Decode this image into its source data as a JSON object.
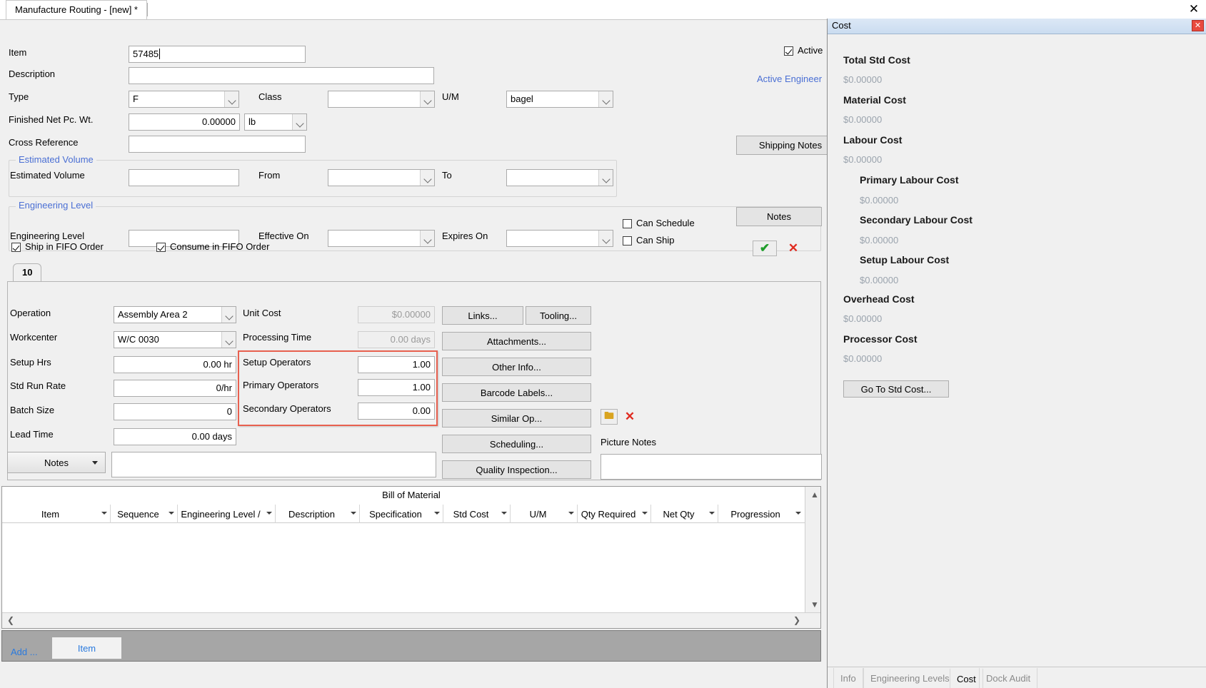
{
  "window": {
    "tab_title": "Manufacture Routing - [new] *",
    "close_icon": "close-icon"
  },
  "header_fields": {
    "item_label": "Item",
    "item_value": "57485",
    "description_label": "Description",
    "description_value": "",
    "type_label": "Type",
    "type_value": "F",
    "class_label": "Class",
    "class_value": "",
    "um_label": "U/M",
    "um_value": "bagel",
    "finished_net_label": "Finished Net Pc. Wt.",
    "finished_net_value": "0.00000",
    "finished_net_unit": "lb",
    "cross_ref_label": "Cross Reference",
    "cross_ref_value": "",
    "active_label": "Active",
    "active_checked": true,
    "active_engineer_link": "Active Engineer",
    "shipping_notes_button": "Shipping Notes"
  },
  "estimated_volume": {
    "group_title": "Estimated Volume",
    "field_label": "Estimated Volume",
    "field_value": "",
    "from_label": "From",
    "from_value": "",
    "to_label": "To",
    "to_value": ""
  },
  "engineering_level": {
    "group_title": "Engineering Level",
    "field_label": "Engineering Level",
    "field_value": "",
    "effective_on_label": "Effective On",
    "effective_on_value": "",
    "expires_on_label": "Expires On",
    "expires_on_value": "",
    "can_schedule_label": "Can Schedule",
    "can_schedule_checked": false,
    "can_ship_label": "Can Ship",
    "can_ship_checked": false,
    "notes_button": "Notes"
  },
  "fifo": {
    "ship_fifo_label": "Ship in FIFO Order",
    "ship_fifo_checked": true,
    "consume_fifo_label": "Consume in FIFO Order",
    "consume_fifo_checked": true,
    "accept_icon": "✔",
    "reject_icon": "✕"
  },
  "operation_tab": {
    "tab_label": "10"
  },
  "operation": {
    "operation_label": "Operation",
    "operation_value": "Assembly Area 2",
    "workcenter_label": "Workcenter",
    "workcenter_value": "W/C 0030",
    "setup_hrs_label": "Setup Hrs",
    "setup_hrs_value": "0.00 hr",
    "std_run_rate_label": "Std Run Rate",
    "std_run_rate_value": "0/hr",
    "batch_size_label": "Batch Size",
    "batch_size_value": "0",
    "lead_time_label": "Lead Time",
    "lead_time_value": "0.00 days",
    "unit_cost_label": "Unit Cost",
    "unit_cost_value": "$0.00000",
    "processing_time_label": "Processing Time",
    "processing_time_value": "0.00 days",
    "setup_operators_label": "Setup Operators",
    "setup_operators_value": "1.00",
    "primary_operators_label": "Primary Operators",
    "primary_operators_value": "1.00",
    "secondary_operators_label": "Secondary Operators",
    "secondary_operators_value": "0.00",
    "highlight_color": "#e8604f",
    "notes_button": "Notes",
    "notes_value": "",
    "picture_notes_label": "Picture Notes",
    "picture_notes_value": "",
    "buttons": [
      "Links...",
      "Tooling...",
      "Attachments...",
      "Other Info...",
      "Barcode Labels...",
      "Similar Op...",
      "Scheduling...",
      "Quality Inspection..."
    ]
  },
  "bom": {
    "title": "Bill of Material",
    "columns": [
      "Item",
      "Sequence",
      "Engineering Level /",
      "Description",
      "Specification",
      "Std Cost",
      "U/M",
      "Qty Required",
      "Net Qty",
      "Progression"
    ],
    "rows": []
  },
  "bottom_bar": {
    "add_link": "Add ...",
    "item_tab": "Item"
  },
  "cost_panel": {
    "title": "Cost",
    "close_icon": "close-icon",
    "entries": [
      {
        "label": "Total Std Cost",
        "value": "$0.00000",
        "indent": 0
      },
      {
        "label": "Material Cost",
        "value": "$0.00000",
        "indent": 0
      },
      {
        "label": "Labour Cost",
        "value": "$0.00000",
        "indent": 0
      },
      {
        "label": "Primary Labour Cost",
        "value": "$0.00000",
        "indent": 1
      },
      {
        "label": "Secondary Labour Cost",
        "value": "$0.00000",
        "indent": 1
      },
      {
        "label": "Setup Labour Cost",
        "value": "$0.00000",
        "indent": 1
      },
      {
        "label": "Overhead Cost",
        "value": "$0.00000",
        "indent": 0
      },
      {
        "label": "Processor Cost",
        "value": "$0.00000",
        "indent": 0
      }
    ],
    "go_to_std_cost_button": "Go To Std Cost...",
    "tabs": [
      {
        "label": "Info",
        "active": false
      },
      {
        "label": "Engineering Levels",
        "active": false
      },
      {
        "label": "Cost",
        "active": true
      },
      {
        "label": "Dock Audit",
        "active": false
      }
    ]
  }
}
